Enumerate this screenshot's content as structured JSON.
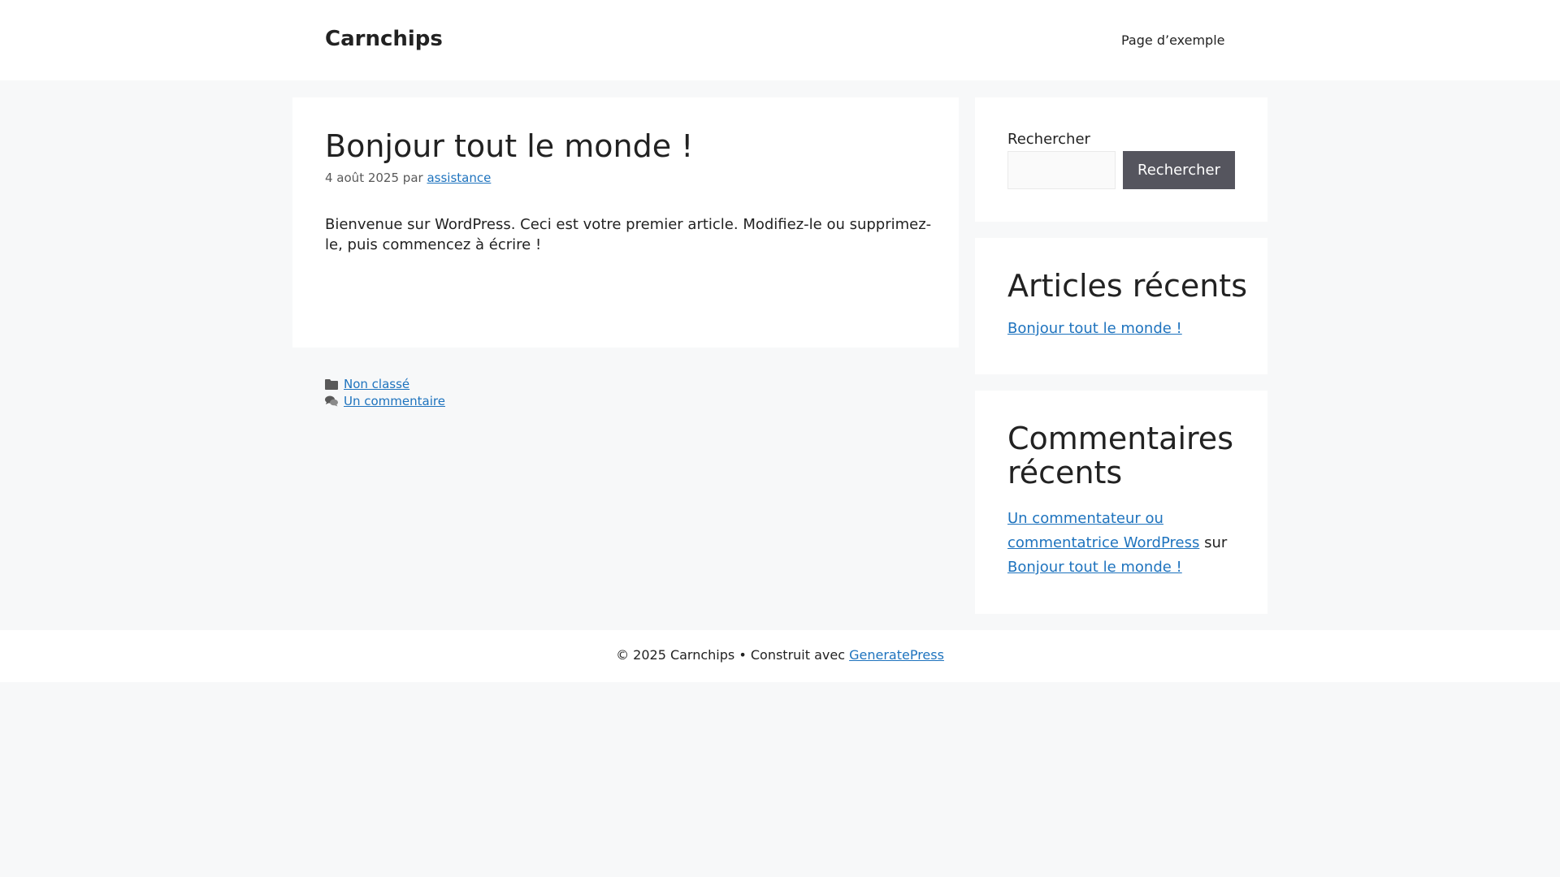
{
  "header": {
    "site_title": "Carnchips",
    "nav": [
      {
        "label": "Page d’exemple"
      }
    ]
  },
  "post": {
    "title": "Bonjour tout le monde !",
    "date": "4 août 2025",
    "by": "par",
    "author": "assistance",
    "content": "Bienvenue sur WordPress. Ceci est votre premier article. Modifiez-le ou supprimez-le, puis commencez à écrire !",
    "category": "Non classé",
    "comments_link": "Un commentaire"
  },
  "sidebar": {
    "search": {
      "label": "Rechercher",
      "value": "",
      "button_label": "Rechercher"
    },
    "recent_posts": {
      "title": "Articles récents",
      "items": [
        {
          "label": "Bonjour tout le monde !"
        }
      ]
    },
    "recent_comments": {
      "title": "Commentaires récents",
      "items": [
        {
          "author": "Un commentateur ou commentatrice WordPress",
          "on": "sur",
          "post": "Bonjour tout le monde !"
        }
      ]
    }
  },
  "footer": {
    "copyright": "© 2025 Carnchips • Construit avec",
    "link": "GeneratePress"
  },
  "icons": {
    "category": "folder-icon",
    "comments": "comments-icon"
  },
  "colors": {
    "link": "#1e73be",
    "button_bg": "#55555e",
    "page_bg": "#f7f8f9"
  }
}
